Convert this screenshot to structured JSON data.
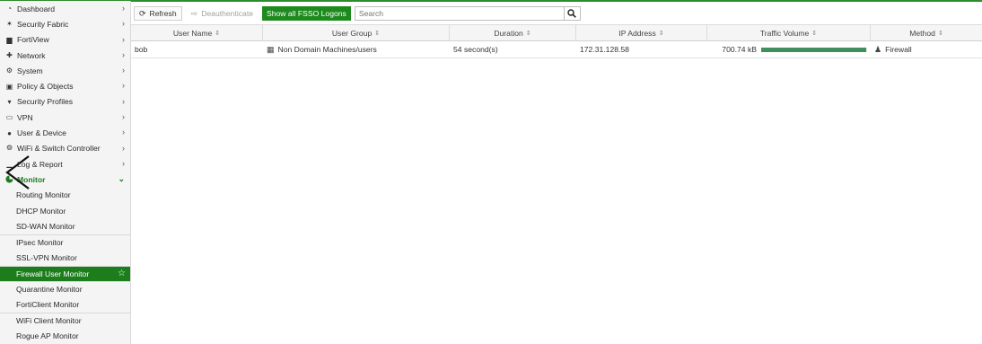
{
  "sidebar": {
    "nav": [
      {
        "label": "Dashboard",
        "icon": "dashboard-icon",
        "glyph": "◔"
      },
      {
        "label": "Security Fabric",
        "icon": "security-fabric-icon",
        "glyph": "✶"
      },
      {
        "label": "FortiView",
        "icon": "fortiview-icon",
        "glyph": "▆"
      },
      {
        "label": "Network",
        "icon": "network-icon",
        "glyph": "✚"
      },
      {
        "label": "System",
        "icon": "gear-icon",
        "glyph": "⚙"
      },
      {
        "label": "Policy & Objects",
        "icon": "policy-icon",
        "glyph": "▣"
      },
      {
        "label": "Security Profiles",
        "icon": "lock-icon",
        "glyph": "▾"
      },
      {
        "label": "VPN",
        "icon": "vpn-icon",
        "glyph": "▭"
      },
      {
        "label": "User & Device",
        "icon": "user-icon",
        "glyph": "●"
      },
      {
        "label": "WiFi & Switch Controller",
        "icon": "wifi-icon",
        "glyph": "⨷"
      },
      {
        "label": "Log & Report",
        "icon": "log-report-icon",
        "glyph": "▁"
      }
    ],
    "monitor": {
      "label": "Monitor",
      "icon": "monitor-icon"
    },
    "monitor_items": [
      {
        "label": "Routing Monitor",
        "sep": false,
        "active": false
      },
      {
        "label": "DHCP Monitor",
        "sep": false,
        "active": false
      },
      {
        "label": "SD-WAN Monitor",
        "sep": false,
        "active": false
      },
      {
        "label": "IPsec Monitor",
        "sep": true,
        "active": false
      },
      {
        "label": "SSL-VPN Monitor",
        "sep": false,
        "active": false
      },
      {
        "label": "Firewall User Monitor",
        "sep": true,
        "active": true
      },
      {
        "label": "Quarantine Monitor",
        "sep": true,
        "active": false
      },
      {
        "label": "FortiClient Monitor",
        "sep": false,
        "active": false
      },
      {
        "label": "WiFi Client Monitor",
        "sep": true,
        "active": false
      },
      {
        "label": "Rogue AP Monitor",
        "sep": false,
        "active": false
      }
    ]
  },
  "toolbar": {
    "refresh_label": "Refresh",
    "deauth_label": "Deauthenticate",
    "fsso_label": "Show all FSSO Logons",
    "search_placeholder": "Search"
  },
  "table": {
    "columns": [
      "User Name",
      "User Group",
      "Duration",
      "IP Address",
      "Traffic Volume",
      "Method"
    ],
    "rows": [
      {
        "user_name": "bob",
        "user_group": "Non Domain Machines/users",
        "duration": "54 second(s)",
        "ip_address": "172.31.128.58",
        "traffic_volume": "700.74 kB",
        "traffic_fraction": 0.99,
        "method": "Firewall"
      }
    ]
  },
  "colors": {
    "accent": "#1d7d1d",
    "bar": "#3f8f5f"
  }
}
